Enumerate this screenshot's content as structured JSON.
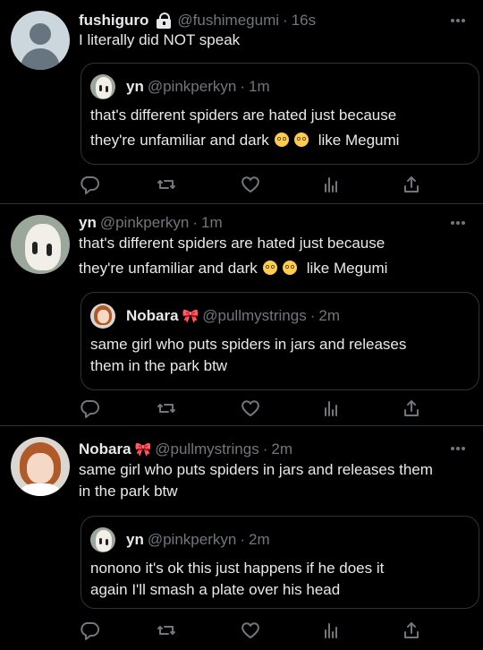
{
  "tweets": [
    {
      "name": "fushiguro",
      "handle": "@fushimegumi",
      "time": "16s",
      "text": "I literally did NOT speak",
      "quote": {
        "name": "yn",
        "handle": "@pinkperkyn",
        "time": "1m",
        "line1": "that's different spiders are hated just because",
        "line2_pre": "they're unfamiliar and dark",
        "line2_post": "like Megumi"
      }
    },
    {
      "name": "yn",
      "handle": "@pinkperkyn",
      "time": "1m",
      "line1": "that's different spiders are hated just because",
      "line2_pre": "they're unfamiliar and dark",
      "line2_post": "like Megumi",
      "quote": {
        "name": "Nobara",
        "handle": "@pullmystrings",
        "time": "2m",
        "line1": "same girl who puts spiders in jars and releases",
        "line2": "them in the park btw"
      }
    },
    {
      "name": "Nobara",
      "handle": "@pullmystrings",
      "time": "2m",
      "line1": "same girl who puts spiders in jars and releases them",
      "line2": "in the park btw",
      "quote": {
        "name": "yn",
        "handle": "@pinkperkyn",
        "time": "2m",
        "line1": "nonono it's ok this just happens if he does it",
        "line2": "again I'll smash a plate over his head"
      }
    }
  ],
  "separator": "·",
  "icons": [
    "reply-icon",
    "retweet-icon",
    "like-icon",
    "analytics-icon",
    "share-icon",
    "more-icon",
    "lock-icon"
  ],
  "colors": {
    "background": "#000000",
    "text": "#e7e9ea",
    "muted": "#71767b",
    "border": "#2f3336"
  }
}
